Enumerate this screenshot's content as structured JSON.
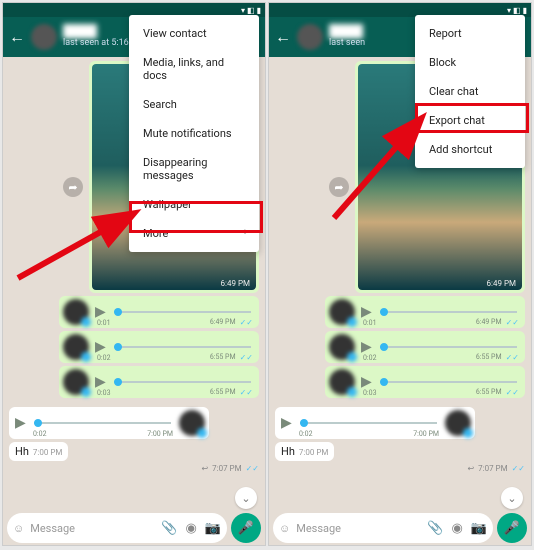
{
  "left": {
    "statusbar_time": "",
    "header": {
      "last_seen": "last seen at 5:16"
    },
    "image_time": "6:49 PM",
    "voices": [
      {
        "duration": "0:01",
        "time": "6:49 PM"
      },
      {
        "duration": "0:02",
        "time": "6:55 PM"
      },
      {
        "duration": "0:03",
        "time": "6:55 PM"
      }
    ],
    "in_voice": {
      "duration": "0:02",
      "time": "7:00 PM"
    },
    "text_msg": {
      "body": "Hh",
      "time": "7:00 PM"
    },
    "reply_time": "7:07 PM",
    "input_placeholder": "Message",
    "menu": {
      "items": [
        "View contact",
        "Media, links, and docs",
        "Search",
        "Mute notifications",
        "Disappearing messages",
        "Wallpaper",
        "More"
      ]
    }
  },
  "right": {
    "header": {
      "last_seen": "last seen"
    },
    "image_time": "6:49 PM",
    "voices": [
      {
        "duration": "0:01",
        "time": "6:49 PM"
      },
      {
        "duration": "0:02",
        "time": "6:55 PM"
      },
      {
        "duration": "0:03",
        "time": "6:55 PM"
      }
    ],
    "in_voice": {
      "duration": "0:02",
      "time": "7:00 PM"
    },
    "text_msg": {
      "body": "Hh",
      "time": "7:00 PM"
    },
    "reply_time": "7:07 PM",
    "input_placeholder": "Message",
    "menu": {
      "items": [
        "Report",
        "Block",
        "Clear chat",
        "Export chat",
        "Add shortcut"
      ]
    }
  },
  "colors": {
    "whatsapp_header": "#075e54",
    "bubble_out": "#dcf8c6",
    "highlight": "#e30613",
    "accent": "#00a884"
  }
}
